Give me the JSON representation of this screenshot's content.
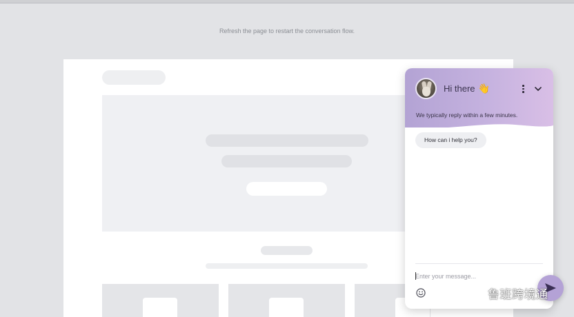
{
  "page": {
    "hint": "Refresh the page to restart the conversation flow."
  },
  "chat": {
    "greeting": "Hi there",
    "greeting_emoji": "👋",
    "subtitle": "We typically reply within a few minutes.",
    "messages": [
      {
        "from": "bot",
        "text": "How can i help you?"
      }
    ],
    "input": {
      "placeholder": "Enter your message...",
      "value": ""
    },
    "icons": {
      "menu": "more-vertical-icon",
      "collapse": "chevron-down-icon",
      "emoji": "smiley-icon",
      "send": "send-arrow-icon"
    },
    "colors": {
      "header_start": "#b3a3d4",
      "header_end": "#d9bfe6",
      "bubble_bg": "#eeeff2",
      "send_button": "#b4a2d6"
    }
  },
  "watermark": {
    "text": "鲁班跨境通"
  }
}
